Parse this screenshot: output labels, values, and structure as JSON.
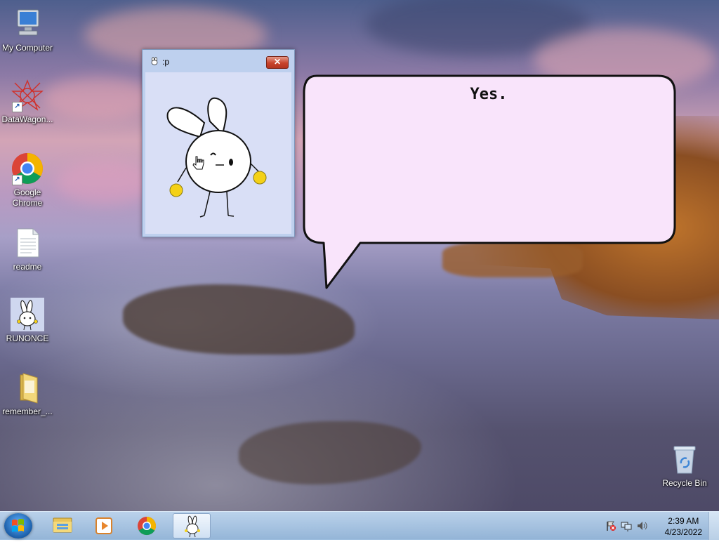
{
  "desktop": {
    "icons": [
      {
        "label": "My Computer",
        "icon": "computer-icon"
      },
      {
        "label": "DataWagon...",
        "icon": "datawagon-icon"
      },
      {
        "label": "Google Chrome",
        "icon": "chrome-icon"
      },
      {
        "label": "readme",
        "icon": "text-file-icon"
      },
      {
        "label": "RUNONCE",
        "icon": "bunny-icon"
      },
      {
        "label": "remember_...",
        "icon": "folder-icon"
      },
      {
        "label": "Recycle Bin",
        "icon": "recycle-bin-icon"
      }
    ]
  },
  "window": {
    "title": ":p",
    "close_label": "✕"
  },
  "bubble": {
    "text": "Yes."
  },
  "taskbar": {
    "items": [
      {
        "name": "Windows Explorer",
        "icon": "folder-icon"
      },
      {
        "name": "Windows Media Player",
        "icon": "media-player-icon"
      },
      {
        "name": "Google Chrome",
        "icon": "chrome-icon"
      },
      {
        "name": "Bunny app",
        "icon": "bunny-icon"
      }
    ],
    "clock_time": "2:39 AM",
    "clock_date": "4/23/2022"
  },
  "colors": {
    "window_bg": "#bed0ee",
    "bubble_fill": "#f9e4fb",
    "close_red": "#c8432b"
  }
}
